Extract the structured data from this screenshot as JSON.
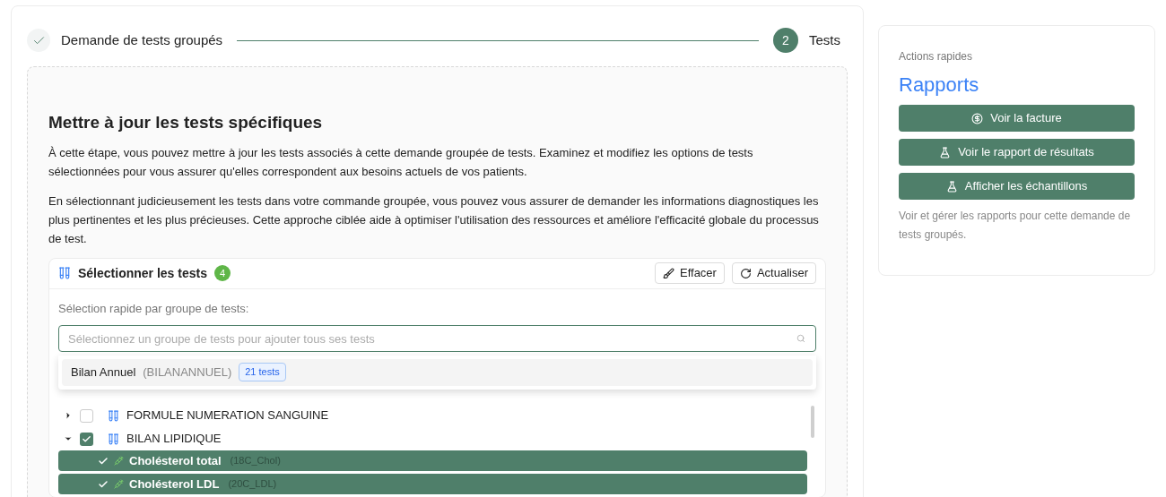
{
  "stepper": [
    {
      "label": "Demande de tests groupés",
      "done": true
    },
    {
      "label": "Tests",
      "done": false,
      "number": "2"
    }
  ],
  "section": {
    "title": "Mettre à jour les tests spécifiques",
    "paragraphs": [
      "À cette étape, vous pouvez mettre à jour les tests associés à cette demande groupée de tests. Examinez et modifiez les options de tests sélectionnées pour vous assurer qu'elles correspondent aux besoins actuels de vos patients.",
      "En sélectionnant judicieusement les tests dans votre commande groupée, vous pouvez vous assurer de demander les informations diagnostiques les plus pertinentes et les plus précieuses. Cette approche ciblée aide à optimiser l'utilisation des ressources et améliore l'efficacité globale du processus de test."
    ]
  },
  "selector": {
    "title": "Sélectionner les tests",
    "count": "4",
    "buttons": [
      {
        "kind": "clear",
        "label": "Effacer"
      },
      {
        "kind": "refresh",
        "label": "Actualiser"
      }
    ],
    "quick_label": "Sélection rapide par groupe de tests:",
    "search": {
      "placeholder": "Sélectionnez un groupe de tests pour ajouter tous ses tests"
    },
    "options": [
      {
        "name": "Bilan Annuel",
        "code": "(BILANANNUEL)",
        "badge": "21 tests"
      }
    ],
    "tree": [
      {
        "label": "FORMULE NUMERATION SANGUINE",
        "checked": false,
        "expanded": false
      },
      {
        "label": "BILAN LIPIDIQUE",
        "checked": true,
        "expanded": true,
        "children": [
          {
            "name": "Cholésterol total",
            "code": "(18C_Chol)",
            "selected": true
          },
          {
            "name": "Cholésterol LDL",
            "code": "(20C_LDL)",
            "selected": true
          }
        ]
      }
    ]
  },
  "quick_actions": {
    "caption": "Actions rapides",
    "title": "Rapports",
    "buttons": [
      {
        "kind": "invoice",
        "label": "Voir la facture"
      },
      {
        "kind": "flask",
        "label": "Voir le rapport de résultats"
      },
      {
        "kind": "flask",
        "label": "Afficher les échantillons"
      }
    ],
    "note": "Voir et gérer les rapports pour cette demande de tests groupés."
  }
}
